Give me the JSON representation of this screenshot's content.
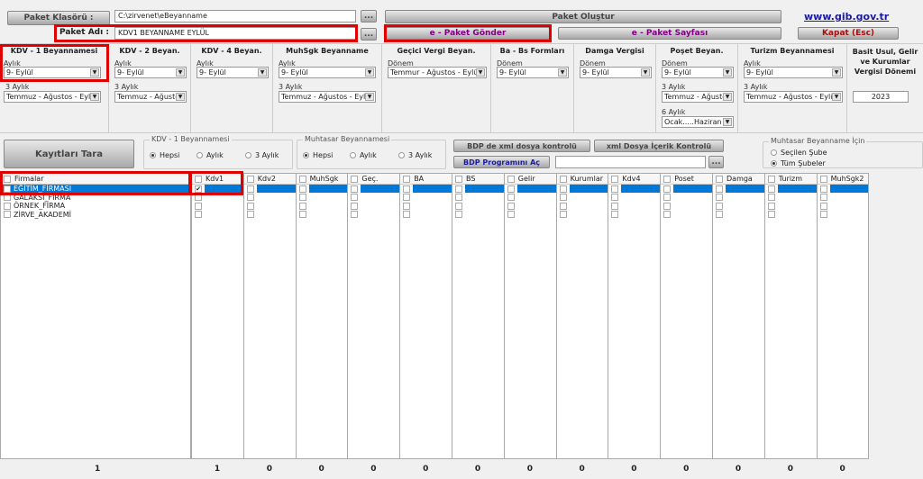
{
  "header": {
    "paket_klasoru_label": "Paket Klasörü :",
    "paket_klasoru_value": "C:\\zirvenet\\eBeyanname",
    "paket_adi_label": "Paket Adı :",
    "paket_adi_value": "KDV1 BEYANNAME EYLÜL",
    "browse": "...",
    "paket_olustur": "Paket Oluştur",
    "e_paket_gonder": "e - Paket Gönder",
    "e_paket_sayfasi": "e - Paket Sayfası",
    "kapat": "Kapat (Esc)",
    "gib_link": "www.gib.gov.tr"
  },
  "sections": {
    "kdv1": {
      "title": "KDV - 1 Beyannamesi",
      "l1": "Aylık",
      "v1": "9- Eylül",
      "l2": "3 Aylık",
      "v2": "Temmuz - Ağustos - Eylül"
    },
    "kdv2": {
      "title": "KDV - 2 Beyan.",
      "l1": "Aylık",
      "v1": "9- Eylül",
      "l2": "3 Aylık",
      "v2": "Temmuz - Ağustos"
    },
    "kdv4": {
      "title": "KDV - 4 Beyan.",
      "l1": "Aylık",
      "v1": "9- Eylül"
    },
    "muhsgk": {
      "title": "MuhSgk Beyanname",
      "l1": "Aylık",
      "v1": "9- Eylül",
      "l2": "3 Aylık",
      "v2": "Temmuz - Ağustos - Eylül"
    },
    "gecici": {
      "title": "Geçici Vergi Beyan.",
      "l1": "Dönem",
      "v1": "Temmur - Ağustos - Eylül"
    },
    "babs": {
      "title": "Ba - Bs Formları",
      "l1": "Dönem",
      "v1": "9- Eylül"
    },
    "damga": {
      "title": "Damga Vergisi",
      "l1": "Dönem",
      "v1": "9- Eylül"
    },
    "poset": {
      "title": "Poşet Beyan.",
      "l1": "Dönem",
      "v1": "9- Eylül",
      "l2": "3 Aylık",
      "v2": "Temmuz - Ağustos",
      "l3": "6 Aylık",
      "v3": "Ocak.....Haziran"
    },
    "turizm": {
      "title": "Turizm Beyannamesi",
      "l1": "Aylık",
      "v1": "9- Eylül",
      "l2": "3 Aylık",
      "v2": "Temmuz - Ağustos - Eylül"
    },
    "basit": {
      "title": "Basit Usul, Gelir ve Kurumlar Vergisi Dönemi",
      "v1": "2023"
    }
  },
  "filters": {
    "kayitlari_tara": "Kayıtları Tara",
    "kdv1_group": "KDV - 1 Beyannamesi",
    "muhtasar_group": "Muhtasar Beyannamesi",
    "hepsi": "Hepsi",
    "aylik": "Aylık",
    "uc_aylik": "3 Aylık",
    "bdp_xml": "BDP de xml dosya kontrolü",
    "xml_icerik": "xml Dosya İçerik Kontrolü",
    "bdp_ac": "BDP Programını Aç",
    "bdp_path": "",
    "sube_group": "Muhtasar Beyanname İçin",
    "secilen_sube": "Seçilen Şube",
    "tum_subeler": "Tüm Şubeler"
  },
  "firms": {
    "header": "Firmalar",
    "items": [
      {
        "name": "EĞİTİM_FİRMASI",
        "checked": true,
        "selected": true
      },
      {
        "name": "GALAKSİ_FİRMA"
      },
      {
        "name": "ÖRNEK_FİRMA"
      },
      {
        "name": "ZİRVE_AKADEMİ"
      }
    ],
    "count": "1"
  },
  "columns": [
    {
      "name": "Kdv1",
      "count": "1",
      "checked_first": true
    },
    {
      "name": "Kdv2",
      "count": "0"
    },
    {
      "name": "MuhSgk",
      "count": "0"
    },
    {
      "name": "Geç.",
      "count": "0"
    },
    {
      "name": "BA",
      "count": "0"
    },
    {
      "name": "BS",
      "count": "0"
    },
    {
      "name": "Gelir",
      "count": "0"
    },
    {
      "name": "Kurumlar",
      "count": "0"
    },
    {
      "name": "Kdv4",
      "count": "0"
    },
    {
      "name": "Poset",
      "count": "0"
    },
    {
      "name": "Damga",
      "count": "0"
    },
    {
      "name": "Turizm",
      "count": "0"
    },
    {
      "name": "MuhSgk2",
      "count": "0"
    }
  ],
  "colors": {
    "highlight": "#e00000",
    "selection": "#0078d7",
    "link": "#1a1aa6",
    "purple": "#800080",
    "kapat": "#a01010"
  }
}
